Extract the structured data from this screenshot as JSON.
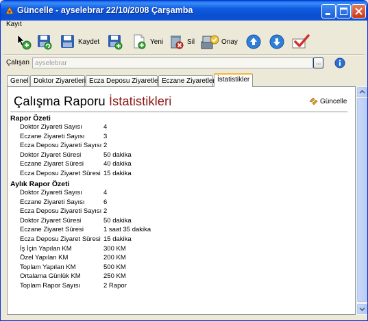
{
  "window": {
    "title": "Güncelle - ayselebrar 22/10/2008 Çarşamba"
  },
  "menu": {
    "items": [
      {
        "label": "Kayıt"
      }
    ]
  },
  "toolbar": {
    "save_label": "Kaydet",
    "new_label": "Yeni",
    "delete_label": "Sil",
    "approve_label": "Onay"
  },
  "employee": {
    "label": "Çalışan",
    "value": "ayselebrar",
    "browse_label": "..."
  },
  "tabs": [
    {
      "label": "Genel"
    },
    {
      "label": "Doktor Ziyaretleri"
    },
    {
      "label": "Ecza Deposu Ziyaretleri"
    },
    {
      "label": "Eczane Ziyaretleri"
    },
    {
      "label": "İstatistikler"
    }
  ],
  "report": {
    "title_part1": "Çalışma Raporu",
    "title_part2": "İstatistikleri",
    "refresh_label": "Güncelle",
    "summary": {
      "heading": "Rapor Özeti",
      "rows": [
        {
          "key": "Doktor Ziyareti Sayısı",
          "value": "4"
        },
        {
          "key": "Eczane Ziyareti Sayısı",
          "value": "3"
        },
        {
          "key": "Ecza Deposu Ziyareti Sayısı",
          "value": "2"
        },
        {
          "key": "Doktor Ziyaret Süresi",
          "value": "50 dakika"
        },
        {
          "key": "Eczane Ziyaret Süresi",
          "value": "40 dakika"
        },
        {
          "key": "Ecza Deposu Ziyaret Süresi",
          "value": "15 dakika"
        }
      ]
    },
    "monthly": {
      "heading": "Aylık Rapor Özeti",
      "rows": [
        {
          "key": "Doktor Ziyareti Sayısı",
          "value": "4"
        },
        {
          "key": "Eczane Ziyareti Sayısı",
          "value": "6"
        },
        {
          "key": "Ecza Deposu Ziyareti Sayısı",
          "value": "2"
        },
        {
          "key": "Doktor Ziyaret Süresi",
          "value": "50 dakika"
        },
        {
          "key": "Eczane Ziyaret Süresi",
          "value": "1 saat 35 dakika"
        },
        {
          "key": "Ecza Deposu Ziyaret Süresi",
          "value": "15 dakika"
        },
        {
          "key": "İş İçin Yapılan KM",
          "value": "300 KM"
        },
        {
          "key": "Özel Yapılan KM",
          "value": "200 KM"
        },
        {
          "key": "Toplam Yapılan KM",
          "value": "500 KM"
        },
        {
          "key": "Ortalama Günlük KM",
          "value": "250 KM"
        },
        {
          "key": "Toplam Rapor Sayısı",
          "value": "2 Rapor"
        }
      ]
    }
  },
  "colors": {
    "title_bar": "#0A4FCF",
    "title_accent": "#8B1A1A",
    "active_tab": "#F8B43C"
  },
  "icons": [
    "app-icon",
    "minimize-icon",
    "maximize-icon",
    "close-icon",
    "pointer-add-icon",
    "save-refresh-icon",
    "save-icon",
    "save-add-icon",
    "new-document-icon",
    "delete-icon",
    "approve-icon",
    "arrow-up-icon",
    "arrow-down-icon",
    "check-icon",
    "info-icon",
    "refresh-icon"
  ]
}
